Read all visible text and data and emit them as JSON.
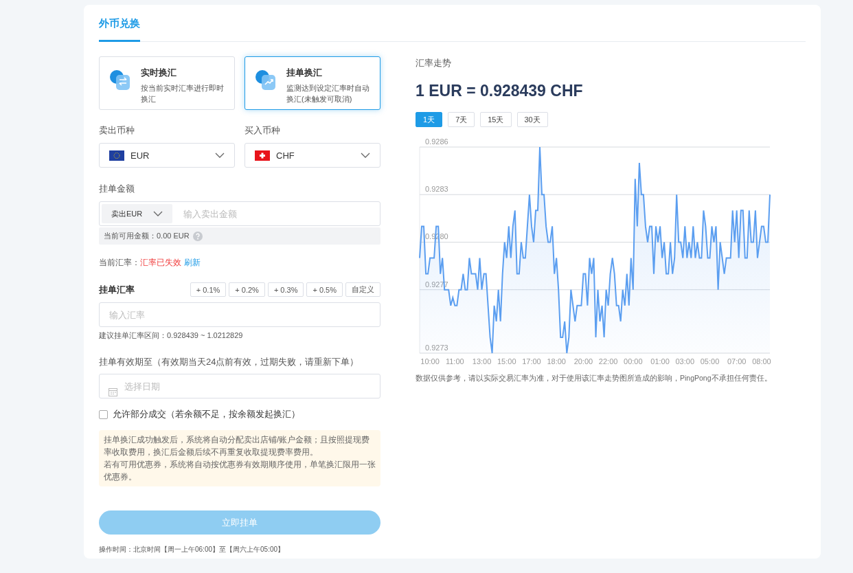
{
  "tabs": [
    {
      "label": "外币兑换",
      "selected": true
    }
  ],
  "modes": [
    {
      "title": "实时换汇",
      "description": "按当前实时汇率进行即时换汇",
      "selected": false
    },
    {
      "title": "挂单换汇",
      "description": "监测达到设定汇率时自动换汇(未触发可取消)",
      "selected": true
    }
  ],
  "sell_currency": {
    "label": "卖出币种",
    "value": "EUR"
  },
  "buy_currency": {
    "label": "买入币种",
    "value": "CHF"
  },
  "amount": {
    "label": "挂单金额",
    "unit": "卖出EUR",
    "placeholder": "输入卖出金额",
    "available": "当前可用金额：0.00 EUR"
  },
  "current_rate": {
    "label": "当前汇率：",
    "status": "汇率已失效",
    "refresh": "刷新"
  },
  "order_rate": {
    "label": "挂单汇率",
    "presets": [
      "+ 0.1%",
      "+ 0.2%",
      "+ 0.3%",
      "+ 0.5%",
      "自定义"
    ],
    "placeholder": "输入汇率",
    "hint": "建议挂单汇率区间：0.928439 ~ 1.0212829"
  },
  "expiry": {
    "label": "挂单有效期至（有效期当天24点前有效，过期失败，请重新下单）",
    "placeholder": "选择日期"
  },
  "partial": {
    "label": "允许部分成交（若余额不足，按余额发起换汇）",
    "checked": false
  },
  "notice": [
    "挂单换汇成功触发后，系统将自动分配卖出店铺/账户金额；且按照提现费率收取费用，换汇后金额后续不再重复收取提现费率费用。",
    "若有可用优惠券，系统将自动按优惠券有效期顺序使用，单笔换汇限用一张优惠券。"
  ],
  "submit": {
    "label": "立即挂单",
    "disabled": true
  },
  "footnote": "操作时间：北京时间【周一上午06:00】至【周六上午05:00】",
  "trend": {
    "title": "汇率走势",
    "rate": "1 EUR = 0.928439 CHF",
    "ranges": [
      {
        "label": "1天",
        "selected": true
      },
      {
        "label": "7天",
        "selected": false
      },
      {
        "label": "15天",
        "selected": false
      },
      {
        "label": "30天",
        "selected": false
      }
    ],
    "chart_data": {
      "type": "area",
      "grid": true,
      "ylim": [
        0.9273,
        0.9286
      ],
      "yticks": [
        {
          "value": 0.9286,
          "label": "0.9286"
        },
        {
          "value": 0.9283,
          "label": "0.9283"
        },
        {
          "value": 0.928,
          "label": "0.9280"
        },
        {
          "value": 0.9277,
          "label": "0.9277"
        },
        {
          "value": 0.9273,
          "label": "0.9273"
        }
      ],
      "categories": [
        null,
        null,
        null,
        null,
        null,
        "10:00",
        null,
        null,
        null,
        null,
        null,
        null,
        null,
        null,
        null,
        null,
        null,
        "11:00",
        null,
        null,
        null,
        null,
        null,
        null,
        null,
        null,
        null,
        null,
        null,
        null,
        "13:00",
        null,
        null,
        null,
        null,
        null,
        null,
        null,
        null,
        null,
        null,
        null,
        "15:00",
        null,
        null,
        null,
        null,
        null,
        null,
        null,
        null,
        null,
        null,
        null,
        "17:00",
        null,
        null,
        null,
        null,
        null,
        null,
        null,
        null,
        null,
        null,
        null,
        "18:00",
        null,
        null,
        null,
        null,
        null,
        null,
        null,
        null,
        null,
        null,
        null,
        null,
        "20:00",
        null,
        null,
        null,
        null,
        null,
        null,
        null,
        null,
        null,
        null,
        null,
        "22:00",
        null,
        null,
        null,
        null,
        null,
        null,
        null,
        null,
        null,
        null,
        null,
        "00:00",
        null,
        null,
        null,
        null,
        null,
        null,
        null,
        null,
        null,
        null,
        null,
        null,
        "01:00",
        null,
        null,
        null,
        null,
        null,
        null,
        null,
        null,
        null,
        null,
        null,
        "03:00",
        null,
        null,
        null,
        null,
        null,
        null,
        null,
        null,
        null,
        null,
        null,
        "05:00",
        null,
        null,
        null,
        null,
        null,
        null,
        null,
        null,
        null,
        null,
        null,
        null,
        "07:00",
        null,
        null,
        null,
        null,
        null,
        null,
        null,
        null,
        null,
        null,
        null,
        "08:00",
        null,
        null,
        null,
        null
      ],
      "series": [
        {
          "color": "#5b9ef0",
          "values": [
            0.9279,
            0.9281,
            0.9281,
            0.9278,
            0.9278,
            0.9279,
            0.9279,
            0.9279,
            0.9281,
            0.9281,
            0.9278,
            0.9279,
            0.9277,
            0.9277,
            0.9277,
            0.9276,
            0.92765,
            0.9276,
            0.9276,
            0.9277,
            0.9277,
            0.9278,
            0.9277,
            0.9277,
            0.9279,
            0.9278,
            0.9278,
            0.9278,
            0.9277,
            0.9279,
            0.9277,
            0.9278,
            0.9278,
            0.9276,
            0.9274,
            0.9273,
            0.9276,
            0.9275,
            0.9277,
            0.9275,
            0.9278,
            0.928,
            0.9279,
            0.9281,
            0.9279,
            0.9281,
            0.9282,
            0.9278,
            0.9278,
            0.928,
            0.9279,
            0.9279,
            0.9281,
            0.9283,
            0.9281,
            0.928,
            0.9282,
            0.9282,
            0.9286,
            0.9283,
            0.9283,
            0.9281,
            0.928,
            0.928,
            0.9281,
            0.9278,
            0.9279,
            0.9277,
            0.9274,
            0.9274,
            0.9275,
            0.9273,
            0.9274,
            0.9277,
            0.9276,
            0.9275,
            0.9276,
            0.9276,
            0.9276,
            0.9278,
            0.9278,
            0.9276,
            0.9279,
            0.9278,
            0.9279,
            0.9274,
            0.9277,
            0.9275,
            0.9276,
            0.9274,
            0.9277,
            0.9276,
            0.9278,
            0.9279,
            0.9278,
            0.9276,
            0.9276,
            0.9275,
            0.9277,
            0.9276,
            0.9278,
            0.9276,
            0.9279,
            0.9277,
            0.9284,
            0.9281,
            0.9285,
            0.9283,
            0.9283,
            0.9281,
            0.928,
            0.9281,
            0.9281,
            0.9278,
            0.9281,
            0.928,
            0.9281,
            0.9279,
            0.928,
            0.9278,
            0.9278,
            0.928,
            0.9278,
            0.9279,
            0.9283,
            0.928,
            0.928,
            0.9279,
            0.9281,
            0.9279,
            0.928,
            0.9279,
            0.9281,
            0.9279,
            0.928,
            0.9279,
            0.9279,
            0.9282,
            0.9281,
            0.9279,
            0.9279,
            0.9281,
            0.928,
            0.9281,
            0.9277,
            0.928,
            0.9279,
            0.9278,
            0.9279,
            0.9279,
            0.9279,
            0.9282,
            0.928,
            0.9282,
            0.9279,
            0.9282,
            0.9282,
            0.9279,
            0.9279,
            0.9282,
            0.928,
            0.928,
            0.9282,
            0.9279,
            0.928,
            0.9281,
            0.9281,
            0.928,
            0.928,
            0.9283
          ]
        }
      ]
    },
    "disclaimer": "数据仅供参考，请以实际交易汇率为准，对于使用该汇率走势图所造成的影响，PingPong不承担任何责任。"
  }
}
